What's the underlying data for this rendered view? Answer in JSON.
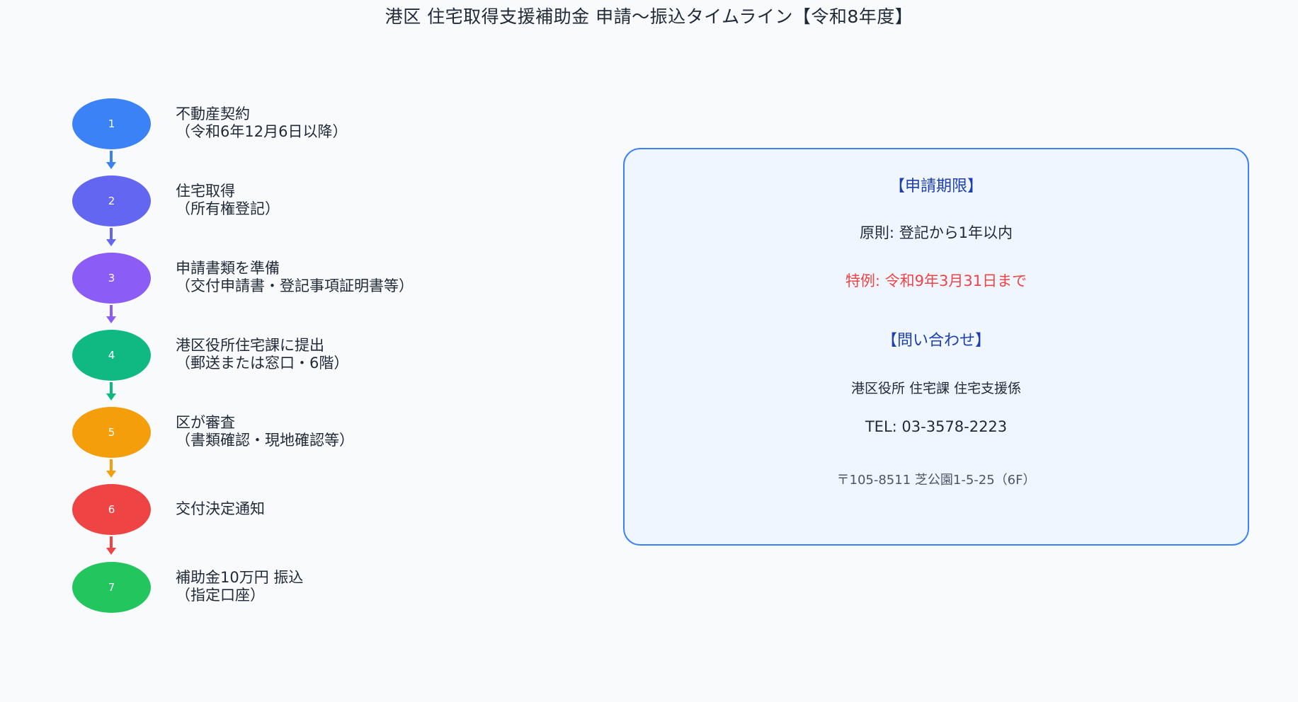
{
  "title": "港区 住宅取得支援補助金 申請〜振込タイムライン【令和8年度】",
  "colors": {
    "step1": "#3b82f6",
    "step2": "#6366f1",
    "step3": "#8b5cf6",
    "step4": "#10b981",
    "step5": "#f59e0b",
    "step6": "#ef4444",
    "step7": "#22c55e",
    "box_border": "#3b82f6",
    "box_fill": "#eff6ff",
    "heading": "#1e40af",
    "special": "#ef4444"
  },
  "steps": [
    {
      "number": "1",
      "label": "不動産契約",
      "sub": "（令和6年12月6日以降）"
    },
    {
      "number": "2",
      "label": "住宅取得",
      "sub": "（所有権登記）"
    },
    {
      "number": "3",
      "label": "申請書類を準備",
      "sub": "（交付申請書・登記事項証明書等）"
    },
    {
      "number": "4",
      "label": "港区役所住宅課に提出",
      "sub": "（郵送または窓口・6階）"
    },
    {
      "number": "5",
      "label": "区が審査",
      "sub": "（書類確認・現地確認等）"
    },
    {
      "number": "6",
      "label": "交付決定通知",
      "sub": ""
    },
    {
      "number": "7",
      "label": "補助金10万円 振込",
      "sub": "（指定口座）"
    }
  ],
  "info": {
    "deadline_heading": "【申請期限】",
    "rule": "原則: 登記から1年以内",
    "special_case": "特例: 令和9年3月31日まで",
    "contact_heading": "【問い合わせ】",
    "office": "港区役所 住宅課 住宅支援係",
    "tel": "TEL: 03-3578-2223",
    "address": "〒105-8511 芝公園1-5-25（6F）"
  }
}
